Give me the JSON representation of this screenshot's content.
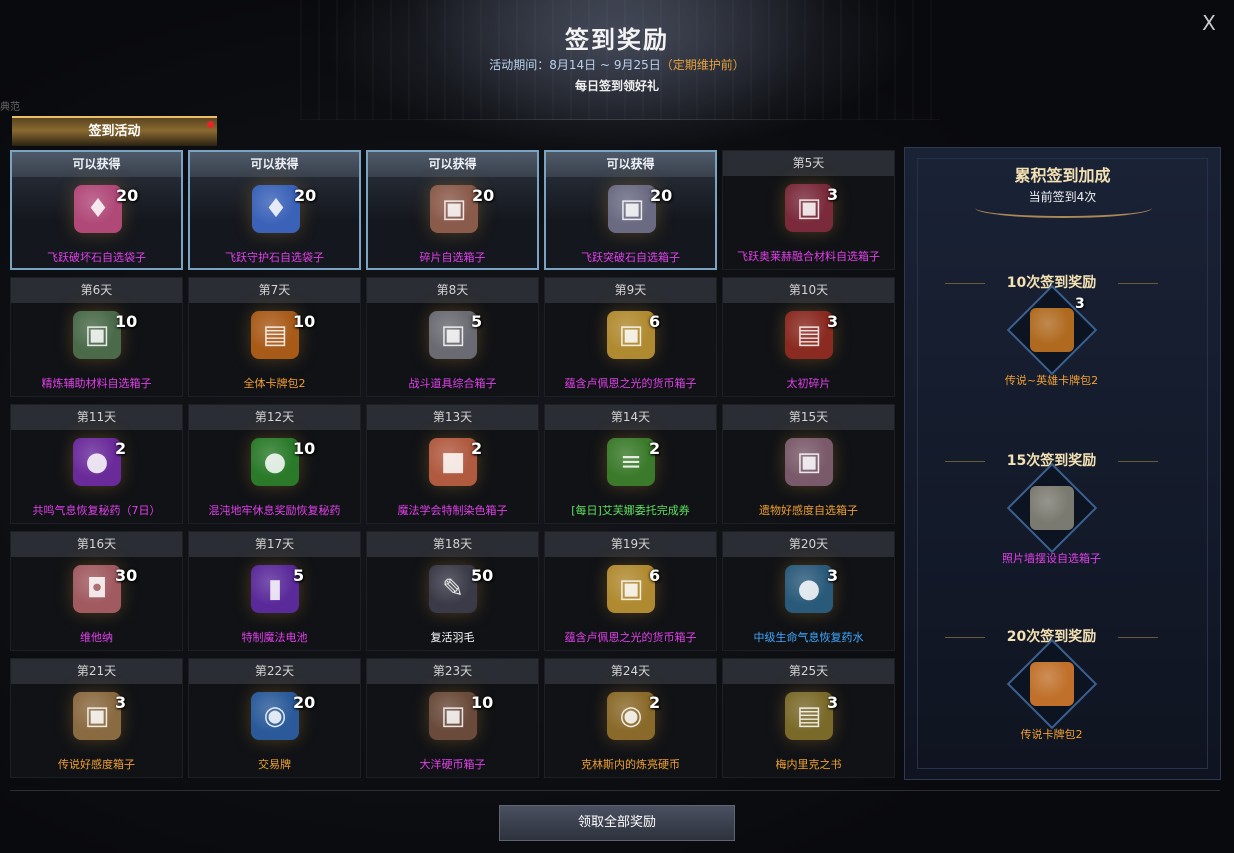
{
  "header": {
    "title": "签到奖励",
    "period": "活动期间：8月14日 ~ 9月25日",
    "period_note": "（定期维护前）",
    "subtitle": "每日签到领好礼",
    "close_label": "X",
    "edge_text": "典范"
  },
  "tab": {
    "label": "签到活动"
  },
  "days": [
    {
      "header": "可以获得",
      "qty": "20",
      "name": "飞跃破坏石自选袋子",
      "color": "#e040e8",
      "claimable": true,
      "icon": "pink-bag-icon",
      "bg": "#b04878",
      "glyph": "♦"
    },
    {
      "header": "可以获得",
      "qty": "20",
      "name": "飞跃守护石自选袋子",
      "color": "#e040e8",
      "claimable": true,
      "icon": "blue-bag-icon",
      "bg": "#3a62b8",
      "glyph": "♦"
    },
    {
      "header": "可以获得",
      "qty": "20",
      "name": "碎片自选箱子",
      "color": "#e040e8",
      "claimable": true,
      "icon": "chest-icon",
      "bg": "#8a5a4a",
      "glyph": "▣"
    },
    {
      "header": "可以获得",
      "qty": "20",
      "name": "飞跃突破石自选箱子",
      "color": "#e040e8",
      "claimable": true,
      "icon": "chest-icon",
      "bg": "#6a6a82",
      "glyph": "▣"
    },
    {
      "header": "第5天",
      "qty": "3",
      "name": "飞跃奥莱赫融合材料自选箱子",
      "color": "#e040e8",
      "claimable": false,
      "icon": "red-chest-icon",
      "bg": "#7a2a3a",
      "glyph": "▣"
    },
    {
      "header": "第6天",
      "qty": "10",
      "name": "精炼辅助材料自选箱子",
      "color": "#e040e8",
      "claimable": false,
      "icon": "green-chest-icon",
      "bg": "#4a6a4a",
      "glyph": "▣"
    },
    {
      "header": "第7天",
      "qty": "10",
      "name": "全体卡牌包2",
      "color": "#f0a030",
      "claimable": false,
      "icon": "card-pack-icon",
      "bg": "#a85a18",
      "glyph": "▤"
    },
    {
      "header": "第8天",
      "qty": "5",
      "name": "战斗道具综合箱子",
      "color": "#e040e8",
      "claimable": false,
      "icon": "chest-icon",
      "bg": "#6a6a72",
      "glyph": "▣"
    },
    {
      "header": "第9天",
      "qty": "6",
      "name": "蕴含卢佩恩之光的货币箱子",
      "color": "#e040e8",
      "claimable": false,
      "icon": "gold-chest-icon",
      "bg": "#b08a30",
      "glyph": "▣"
    },
    {
      "header": "第10天",
      "qty": "3",
      "name": "太初碎片",
      "color": "#e040e8",
      "claimable": false,
      "icon": "card-icon",
      "bg": "#8a2a20",
      "glyph": "▤"
    },
    {
      "header": "第11天",
      "qty": "2",
      "name": "共鸣气息恢复秘药（7日）",
      "color": "#e040e8",
      "claimable": false,
      "icon": "potion-icon",
      "bg": "#6a2a9a",
      "glyph": "●"
    },
    {
      "header": "第12天",
      "qty": "10",
      "name": "混沌地牢休息奖励恢复秘药",
      "color": "#e040e8",
      "claimable": false,
      "icon": "green-orb-icon",
      "bg": "#2a7a2a",
      "glyph": "●"
    },
    {
      "header": "第13天",
      "qty": "2",
      "name": "魔法学会特制染色箱子",
      "color": "#e040e8",
      "claimable": false,
      "icon": "gift-box-icon",
      "bg": "#b05a40",
      "glyph": "■"
    },
    {
      "header": "第14天",
      "qty": "2",
      "name": "[每日]艾芙娜委托完成券",
      "color": "#60e060",
      "claimable": false,
      "icon": "scroll-icon",
      "bg": "#3a7a2a",
      "glyph": "≡"
    },
    {
      "header": "第15天",
      "qty": "",
      "name": "遗物好感度自选箱子",
      "color": "#f0a030",
      "claimable": false,
      "icon": "chest-heart-icon",
      "bg": "#7a5a6a",
      "glyph": "▣"
    },
    {
      "header": "第16天",
      "qty": "30",
      "name": "维他纳",
      "color": "#e040e8",
      "claimable": false,
      "icon": "can-icon",
      "bg": "#a05a60",
      "glyph": "◘"
    },
    {
      "header": "第17天",
      "qty": "5",
      "name": "特制魔法电池",
      "color": "#e040e8",
      "claimable": false,
      "icon": "battery-icon",
      "bg": "#5a2a9a",
      "glyph": "▮"
    },
    {
      "header": "第18天",
      "qty": "50",
      "name": "复活羽毛",
      "color": "#ffffff",
      "claimable": false,
      "icon": "feather-icon",
      "bg": "#3a3a48",
      "glyph": "✎"
    },
    {
      "header": "第19天",
      "qty": "6",
      "name": "蕴含卢佩恩之光的货币箱子",
      "color": "#e040e8",
      "claimable": false,
      "icon": "gold-chest-icon",
      "bg": "#b08a30",
      "glyph": "▣"
    },
    {
      "header": "第20天",
      "qty": "3",
      "name": "中级生命气息恢复药水",
      "color": "#40a8ff",
      "claimable": false,
      "icon": "green-potion-icon",
      "bg": "#2a5a7a",
      "glyph": "●"
    },
    {
      "header": "第21天",
      "qty": "3",
      "name": "传说好感度箱子",
      "color": "#f0a030",
      "claimable": false,
      "icon": "chest-heart-icon",
      "bg": "#8a6a40",
      "glyph": "▣"
    },
    {
      "header": "第22天",
      "qty": "20",
      "name": "交易牌",
      "color": "#f0a030",
      "claimable": false,
      "icon": "blue-token-icon",
      "bg": "#2a5a9a",
      "glyph": "◉"
    },
    {
      "header": "第23天",
      "qty": "10",
      "name": "大洋硬币箱子",
      "color": "#e040e8",
      "claimable": false,
      "icon": "wood-chest-icon",
      "bg": "#6a4a3a",
      "glyph": "▣"
    },
    {
      "header": "第24天",
      "qty": "2",
      "name": "克林斯内的炼亮硬币",
      "color": "#f0a030",
      "claimable": false,
      "icon": "gold-coin-icon",
      "bg": "#8a6a2a",
      "glyph": "◉"
    },
    {
      "header": "第25天",
      "qty": "3",
      "name": "梅内里克之书",
      "color": "#f0a030",
      "claimable": false,
      "icon": "book-icon",
      "bg": "#7a6a2a",
      "glyph": "▤"
    }
  ],
  "side": {
    "title": "累积签到加成",
    "count": "当前签到4次",
    "milestones": [
      {
        "label": "10次签到奖励",
        "qty": "3",
        "name": "传说~英雄卡牌包2",
        "color": "#f0a030",
        "icon": "card-pack-icon",
        "bg": "#b06a20"
      },
      {
        "label": "15次签到奖励",
        "qty": "",
        "name": "照片墙摆设自选箱子",
        "color": "#e040e8",
        "icon": "chest-icon",
        "bg": "#7a7a70"
      },
      {
        "label": "20次签到奖励",
        "qty": "",
        "name": "传说卡牌包2",
        "color": "#f0a030",
        "icon": "book-icon",
        "bg": "#c0702a"
      }
    ]
  },
  "footer": {
    "claim_all": "领取全部奖励"
  }
}
